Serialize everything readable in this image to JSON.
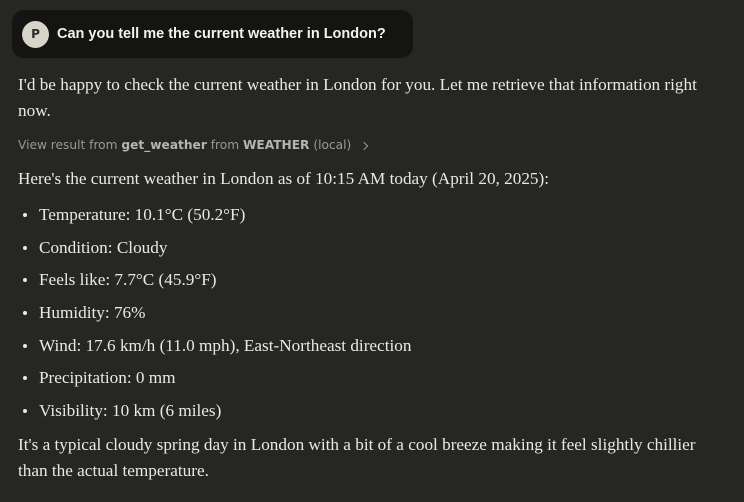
{
  "user_message": {
    "avatar_initial": "P",
    "text": "Can you tell me the current weather in London?"
  },
  "assistant": {
    "intro": "I'd be happy to check the current weather in London for you. Let me retrieve that information right now.",
    "tool_result": {
      "prefix": "View result from",
      "tool_name": "get_weather",
      "from_word": "from",
      "server_name": "WEATHER",
      "scope": "(local)",
      "chevron_icon": "chevron-right-icon"
    },
    "result_heading": "Here's the current weather in London as of 10:15 AM today (April 20, 2025):",
    "bullets": [
      "Temperature: 10.1°C (50.2°F)",
      "Condition: Cloudy",
      "Feels like: 7.7°C (45.9°F)",
      "Humidity: 76%",
      "Wind: 17.6 km/h (11.0 mph), East-Northeast direction",
      "Precipitation: 0 mm",
      "Visibility: 10 km (6 miles)"
    ],
    "summary": "It's a typical cloudy spring day in London with a bit of a cool breeze making it feel slightly chillier than the actual temperature."
  },
  "colors": {
    "background": "#262624",
    "user_bubble": "#141413",
    "avatar_bg": "#d7d4ca",
    "text": "#ebe9e2",
    "muted_text": "#9a9890"
  }
}
